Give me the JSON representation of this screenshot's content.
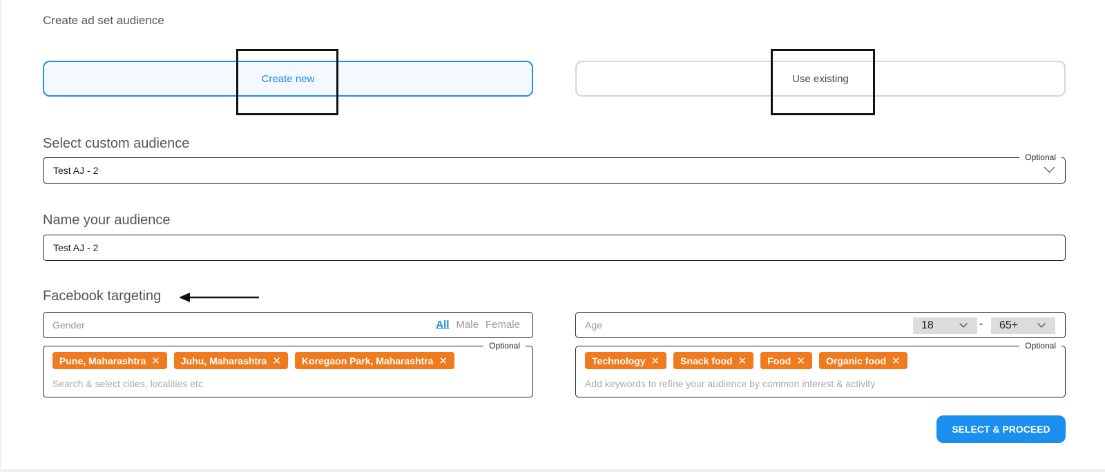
{
  "header": {
    "title": "Create ad set audience"
  },
  "audience_mode": {
    "create_new_label": "Create new",
    "use_existing_label": "Use existing",
    "selected": "Create new"
  },
  "custom_audience": {
    "label": "Select custom audience",
    "value": "Test AJ - 2",
    "optional_label": "Optional"
  },
  "audience_name": {
    "label": "Name your audience",
    "value": "Test AJ - 2"
  },
  "facebook_targeting": {
    "label": "Facebook targeting",
    "gender": {
      "placeholder": "Gender",
      "options": [
        "All",
        "Male",
        "Female"
      ],
      "selected": "All"
    },
    "age": {
      "placeholder": "Age",
      "min": "18",
      "separator": "-",
      "max": "65+"
    },
    "locations": {
      "optional_label": "Optional",
      "tags": [
        "Pune, Maharashtra",
        "Juhu, Maharashtra",
        "Koregaon Park, Maharashtra"
      ],
      "placeholder": "Search & select cities, localities etc"
    },
    "interests": {
      "optional_label": "Optional",
      "tags": [
        "Technology",
        "Snack food",
        "Food",
        "Organic food"
      ],
      "placeholder": "Add keywords to refine your audience by common interest & activity"
    }
  },
  "actions": {
    "proceed_label": "SELECT & PROCEED"
  },
  "colors": {
    "accent": "#1a86e8",
    "tag": "#f07a1e",
    "selected_bg": "#f4f9ff"
  }
}
